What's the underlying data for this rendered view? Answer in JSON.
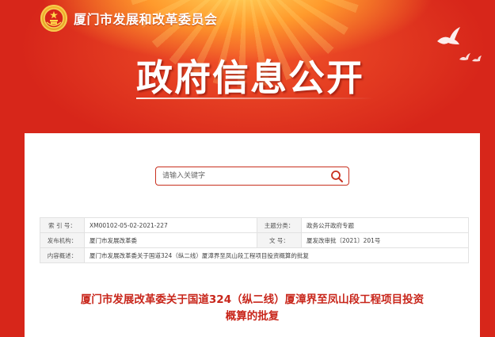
{
  "header": {
    "site_name": "厦门市发展和改革委员会",
    "page_heading": "政府信息公开"
  },
  "search": {
    "placeholder": "请输入关键字"
  },
  "info_table": {
    "rows": [
      {
        "label1": "索 引 号：",
        "value1": "XM00102-05-02-2021-227",
        "label2": "主题分类：",
        "value2": "政务公开政府专题"
      },
      {
        "label1": "发布机构：",
        "value1": "厦门市发展改革委",
        "label2": "文    号：",
        "value2": "厦发改审批〔2021〕201号"
      }
    ],
    "summary_label": "内容概述：",
    "summary_value": "厦门市发展改革委关于国道324（纵二线）厦漳界至凤山段工程项目投资概算的批复"
  },
  "document": {
    "title_line1": "厦门市发展改革委关于国道324（纵二线）厦漳界至凤山段工程项目投资",
    "title_line2": "概算的批复"
  },
  "colors": {
    "banner_red": "#c91f16",
    "accent_red": "#c8261b",
    "title_white": "#ffffff"
  }
}
